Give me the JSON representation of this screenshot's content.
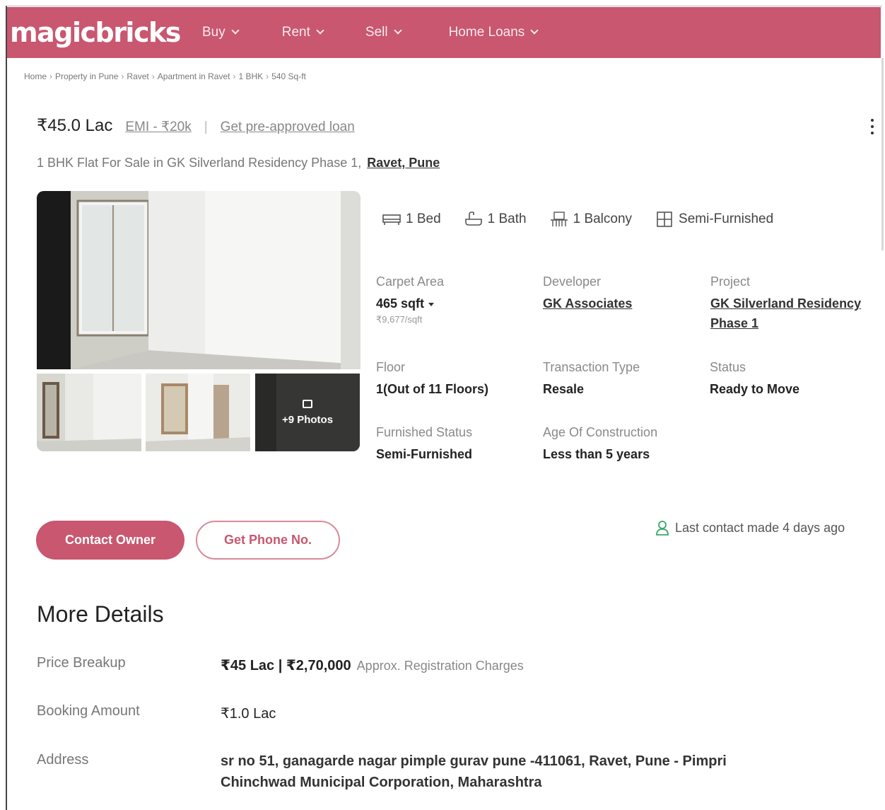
{
  "header": {
    "logo": "magicbricks",
    "nav": [
      {
        "label": "Buy"
      },
      {
        "label": "Rent"
      },
      {
        "label": "Sell"
      },
      {
        "label": "Home Loans"
      }
    ],
    "brand_color": "#c8576f"
  },
  "breadcrumb": [
    "Home",
    "Property in Pune",
    "Ravet",
    "Apartment in Ravet",
    "1 BHK",
    "540 Sq-ft"
  ],
  "listing": {
    "price": "₹45.0 Lac",
    "emi": "EMI - ₹20k",
    "loan_link": "Get pre-approved loan",
    "title": "1 BHK Flat For Sale in GK Silverland Residency Phase 1,",
    "location": "Ravet, Pune"
  },
  "gallery": {
    "more_photos": "+9 Photos"
  },
  "amenities": [
    {
      "icon": "bed-icon",
      "label": "1 Bed"
    },
    {
      "icon": "bath-icon",
      "label": "1 Bath"
    },
    {
      "icon": "balcony-icon",
      "label": "1 Balcony"
    },
    {
      "icon": "furnishing-icon",
      "label": "Semi-Furnished"
    }
  ],
  "facts": {
    "carpet_area": {
      "label": "Carpet Area",
      "value": "465 sqft",
      "sub": "₹9,677/sqft"
    },
    "developer": {
      "label": "Developer",
      "value": "GK Associates"
    },
    "project": {
      "label": "Project",
      "value_line1": "GK Silverland Residency",
      "value_line2": "Phase 1"
    },
    "floor": {
      "label": "Floor",
      "value": "1(Out of 11 Floors)"
    },
    "transaction": {
      "label": "Transaction Type",
      "value": "Resale"
    },
    "status": {
      "label": "Status",
      "value": "Ready to Move"
    },
    "furnished": {
      "label": "Furnished Status",
      "value": "Semi-Furnished"
    },
    "age": {
      "label": "Age Of Construction",
      "value": "Less than 5 years"
    }
  },
  "actions": {
    "contact_owner": "Contact Owner",
    "get_phone": "Get Phone No.",
    "last_contact": "Last contact made 4 days ago"
  },
  "more_details": {
    "title": "More Details",
    "price_breakup_label": "Price Breakup",
    "price_breakup_value": "₹45 Lac | ₹2,70,000",
    "price_breakup_note": "Approx. Registration Charges",
    "booking_label": "Booking Amount",
    "booking_value": "₹1.0 Lac",
    "address_label": "Address",
    "address_line1": "sr no 51, ganagarde nagar pimple gurav pune -411061, Ravet, Pune - Pimpri",
    "address_line2": "Chinchwad Municipal Corporation, Maharashtra"
  }
}
